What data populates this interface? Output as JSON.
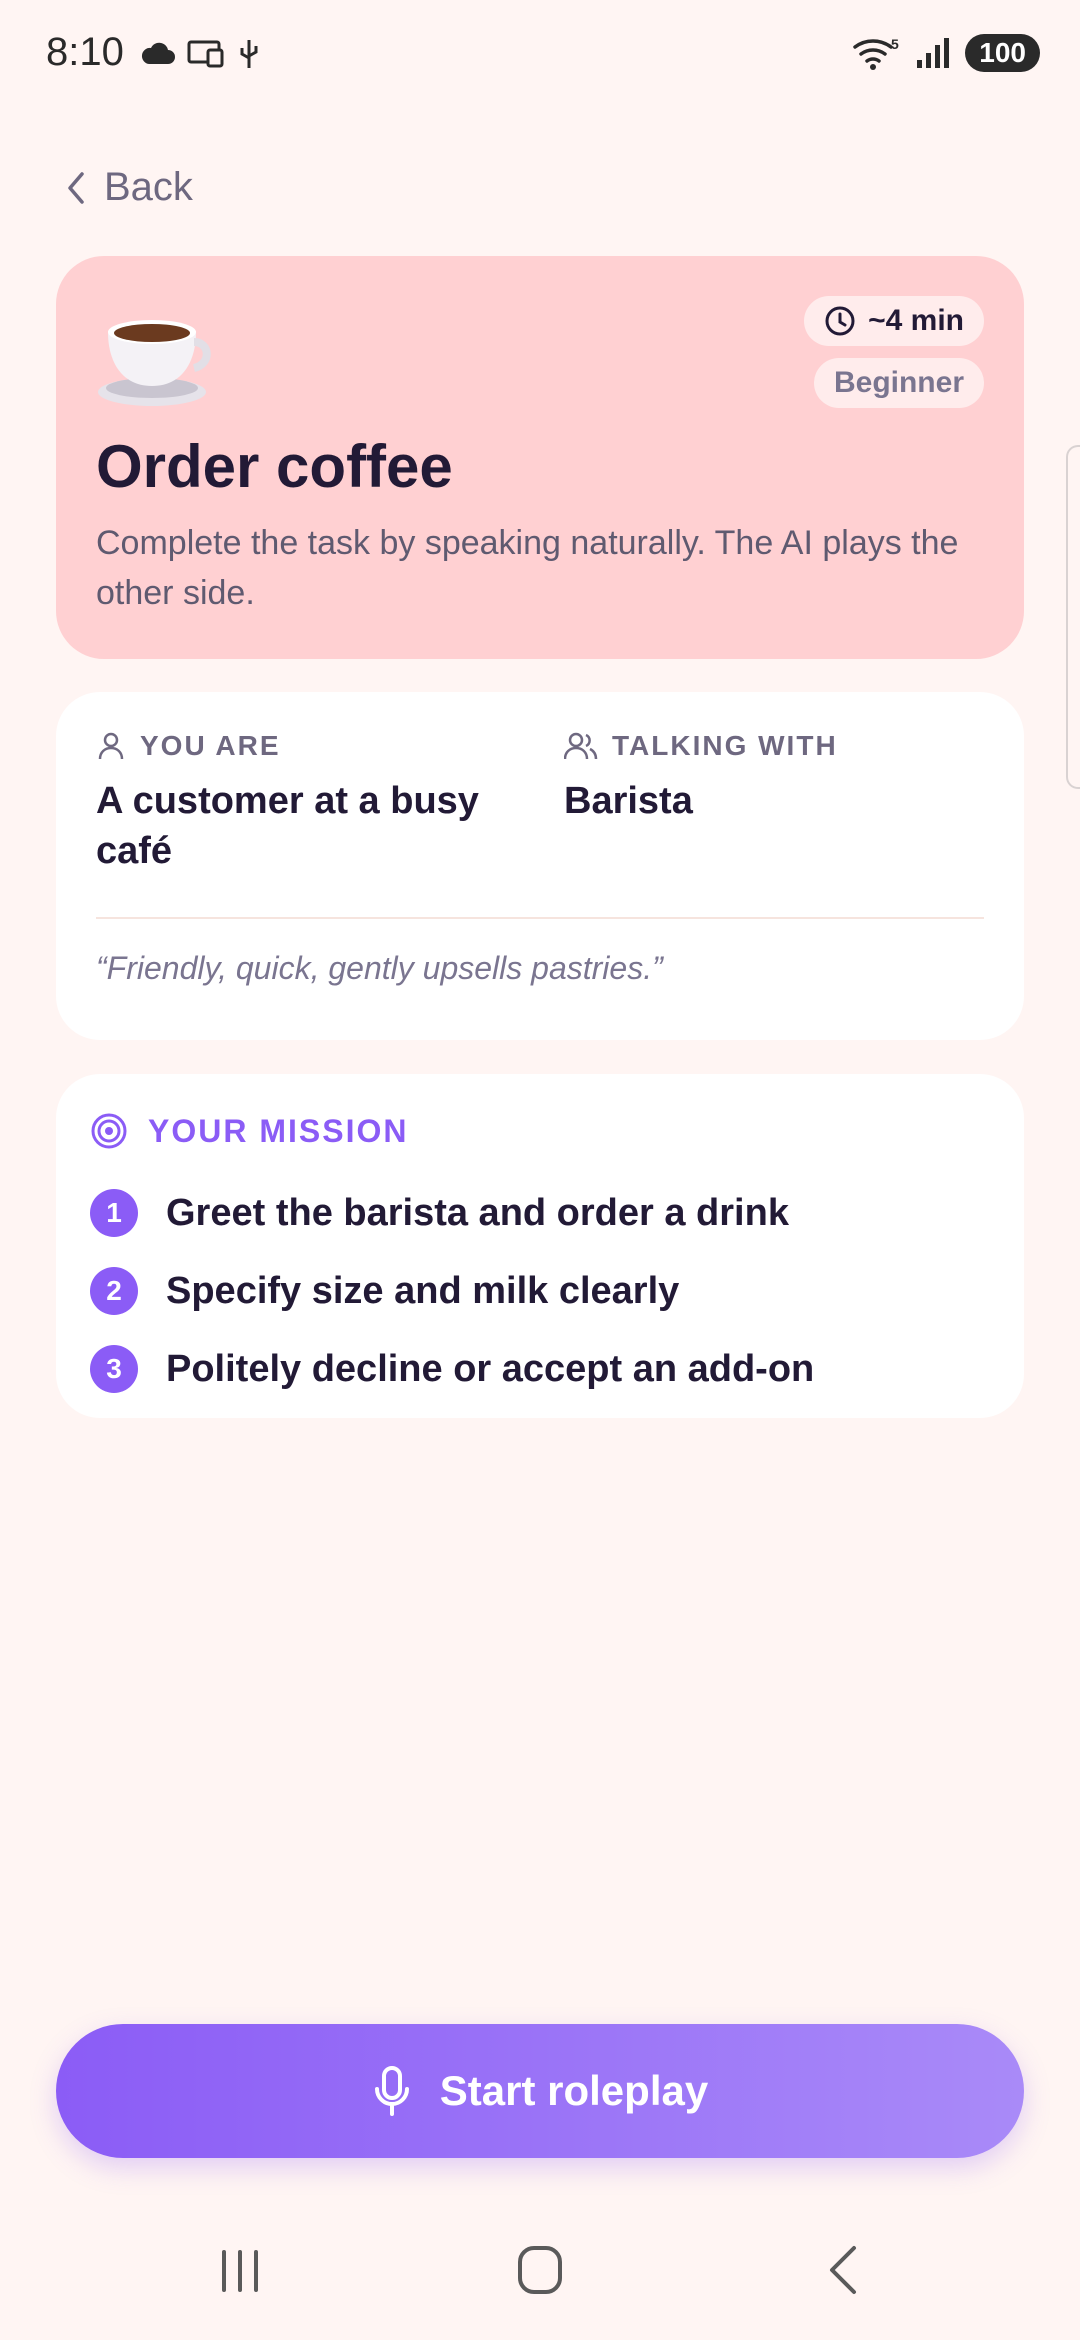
{
  "status": {
    "time": "8:10",
    "battery": "100",
    "wifi_badge": "5"
  },
  "nav": {
    "back_label": "Back"
  },
  "hero": {
    "icon": "coffee-cup-emoji",
    "duration": "~4 min",
    "level": "Beginner",
    "title": "Order coffee",
    "description": "Complete the task by speaking naturally. The AI plays the other side.",
    "background": "#FFD0D2"
  },
  "roles": {
    "you_are_label": "YOU ARE",
    "you_are_value": "A customer at a busy café",
    "talking_with_label": "TALKING WITH",
    "talking_with_value": "Barista",
    "persona_quote": "“Friendly, quick, gently upsells pastries.”"
  },
  "mission": {
    "label": "YOUR MISSION",
    "accent": "#8B5CF6",
    "steps": [
      {
        "num": "1",
        "text": "Greet the barista and order a drink"
      },
      {
        "num": "2",
        "text": "Specify size and milk clearly"
      },
      {
        "num": "3",
        "text": "Politely decline or accept an add-on"
      }
    ]
  },
  "cta": {
    "label": "Start roleplay",
    "icon": "microphone-icon"
  }
}
